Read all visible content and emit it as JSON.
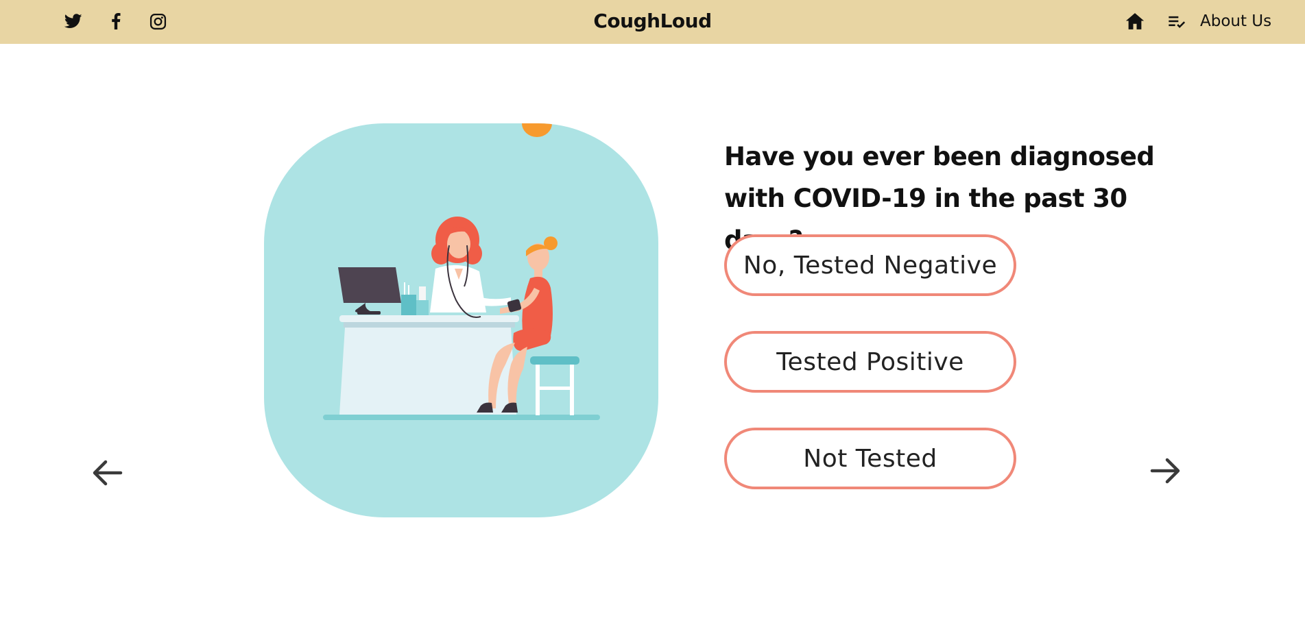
{
  "header": {
    "brand": "CoughLoud",
    "social_icons": [
      "twitter-icon",
      "facebook-icon",
      "instagram-icon"
    ],
    "home_icon": "home-icon",
    "list_icon": "playlist-check-icon",
    "about_label": "About Us",
    "background": "#e8d5a3"
  },
  "main": {
    "illustration": "doctor-checking-patient-blood-pressure",
    "illustration_bg": "#ade3e4",
    "question": "Have you ever been diagnosed with COVID-19 in the past 30 days?",
    "options": [
      {
        "label": "No, Tested Negative"
      },
      {
        "label": "Tested Positive"
      },
      {
        "label": "Not Tested"
      }
    ],
    "option_border_color": "#f08878",
    "prev_icon": "arrow-left-icon",
    "next_icon": "arrow-right-icon"
  }
}
